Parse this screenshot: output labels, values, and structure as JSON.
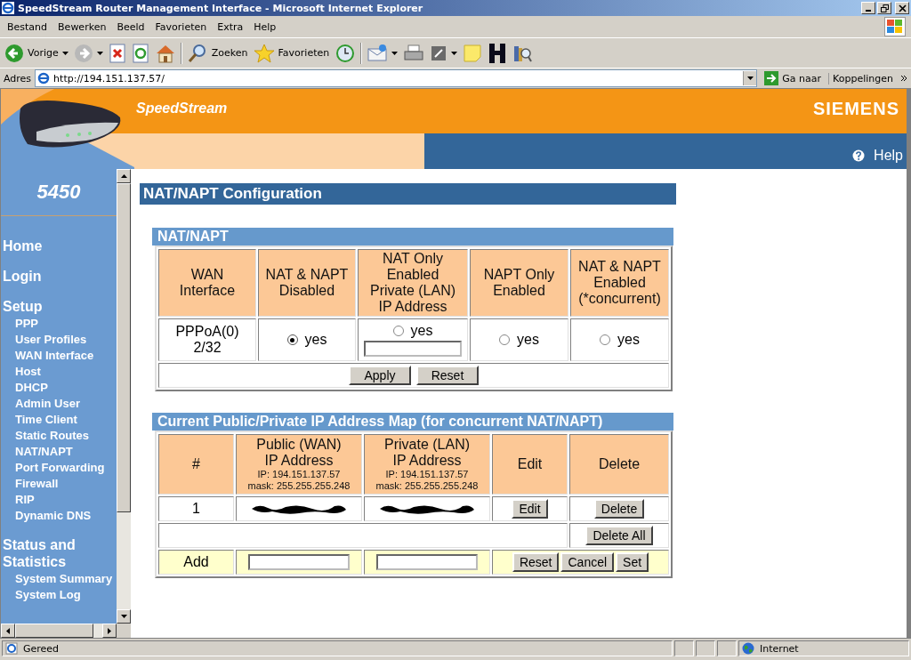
{
  "window": {
    "title": "SpeedStream Router Management Interface - Microsoft Internet Explorer"
  },
  "menu": [
    "Bestand",
    "Bewerken",
    "Beeld",
    "Favorieten",
    "Extra",
    "Help"
  ],
  "toolbar": [
    {
      "kind": "back",
      "label": "Vorige"
    },
    {
      "kind": "forward"
    },
    {
      "kind": "stop"
    },
    {
      "kind": "refresh"
    },
    {
      "kind": "home"
    },
    {
      "kind": "search",
      "label": "Zoeken"
    },
    {
      "kind": "favorites",
      "label": "Favorieten"
    },
    {
      "kind": "history"
    },
    {
      "kind": "mail"
    },
    {
      "kind": "print"
    },
    {
      "kind": "edit"
    },
    {
      "kind": "note"
    },
    {
      "kind": "hblock"
    },
    {
      "kind": "research"
    }
  ],
  "address": {
    "label": "Adres",
    "value": "http://194.151.137.57/",
    "go": "Ga naar",
    "links": "Koppelingen"
  },
  "banner": {
    "brand": "SpeedStream",
    "vendor": "SIEMENS",
    "help": "Help",
    "model": "5450"
  },
  "sidebar": [
    {
      "title": "Home"
    },
    {
      "title": "Login"
    },
    {
      "title": "Setup",
      "items": [
        "PPP",
        "User Profiles",
        "WAN Interface",
        "Host",
        "DHCP",
        "Admin User",
        "Time Client",
        "Static Routes",
        "NAT/NAPT",
        "Port Forwarding",
        "Firewall",
        "RIP",
        "Dynamic DNS"
      ]
    },
    {
      "title": "Status and Statistics",
      "items": [
        "System Summary",
        "System Log"
      ]
    }
  ],
  "page_title": "NAT/NAPT Configuration",
  "nat": {
    "title": "NAT/NAPT",
    "columns": [
      [
        "WAN",
        "Interface"
      ],
      [
        "NAT & NAPT",
        "Disabled"
      ],
      [
        "NAT Only",
        "Enabled",
        "Private (LAN)",
        "IP Address"
      ],
      [
        "NAPT Only",
        "Enabled"
      ],
      [
        "NAT & NAPT",
        "Enabled",
        "(*concurrent)"
      ]
    ],
    "interface": [
      "PPPoA(0)",
      "2/32"
    ],
    "options": [
      {
        "kind": "radio",
        "label": "yes",
        "selected": true
      },
      {
        "kind": "radio_field",
        "label": "yes",
        "selected": false
      },
      {
        "kind": "radio",
        "label": "yes",
        "selected": false
      },
      {
        "kind": "radio",
        "label": "yes",
        "selected": false
      }
    ],
    "buttons": [
      "Apply",
      "Reset"
    ]
  },
  "map": {
    "title": "Current Public/Private IP Address Map (for concurrent NAT/NAPT)",
    "columns": [
      {
        "lines": [
          "#"
        ]
      },
      {
        "lines": [
          "Public (WAN)",
          "IP Address"
        ],
        "notes": [
          "IP: 194.151.137.57",
          "mask: 255.255.255.248"
        ]
      },
      {
        "lines": [
          "Private (LAN)",
          "IP Address"
        ],
        "notes": [
          "IP: 194.151.137.57",
          "mask: 255.255.255.248"
        ]
      },
      {
        "lines": [
          "Edit"
        ]
      },
      {
        "lines": [
          "Delete"
        ]
      }
    ],
    "rows": [
      [
        {
          "kind": "text",
          "text": "1"
        },
        {
          "kind": "redacted"
        },
        {
          "kind": "redacted"
        },
        {
          "kind": "button",
          "text": "Edit"
        },
        {
          "kind": "button",
          "text": "Delete"
        }
      ]
    ],
    "delete_all": "Delete All",
    "add": {
      "label": "Add",
      "buttons": [
        "Reset",
        "Cancel",
        "Set"
      ]
    }
  },
  "status": {
    "text": "Gereed",
    "zone": "Internet"
  }
}
